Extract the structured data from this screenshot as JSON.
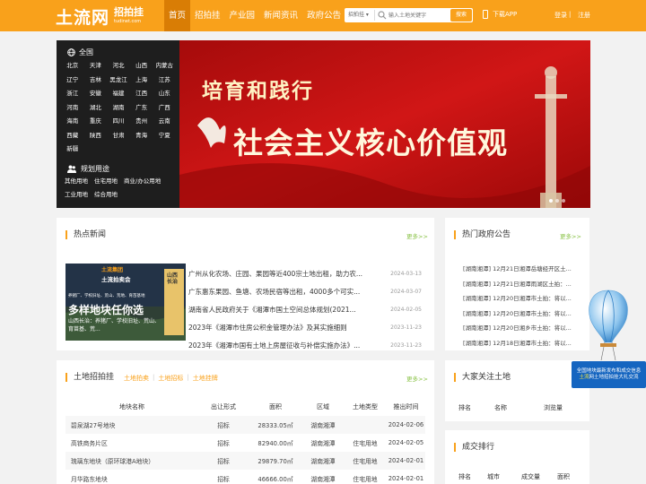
{
  "header": {
    "logo_text": "土流网",
    "logo_sub_cn": "招拍挂",
    "logo_sub_en": "tudinet.com",
    "nav": [
      "首页",
      "招拍挂",
      "产业园",
      "新闻资讯",
      "政府公告"
    ],
    "search_type": "招拍挂 ▾",
    "search_placeholder": "输入土地关键字",
    "search_button": "搜索",
    "app_link": "下载APP",
    "login": "登录",
    "separator": "|",
    "register": "注册",
    "accent_color": "#f9a11b"
  },
  "regions": {
    "heading": "全国",
    "provinces": [
      "北京",
      "天津",
      "河北",
      "山西",
      "内蒙古",
      "辽宁",
      "吉林",
      "黑龙江",
      "上海",
      "江苏",
      "浙江",
      "安徽",
      "福建",
      "江西",
      "山东",
      "河南",
      "湖北",
      "湖南",
      "广东",
      "广西",
      "海南",
      "重庆",
      "四川",
      "贵州",
      "云南",
      "西藏",
      "陕西",
      "甘肃",
      "青海",
      "宁夏",
      "新疆"
    ],
    "plan_heading": "规划用途",
    "uses": [
      "其他用地",
      "住宅用地",
      "商业/办公用地",
      "工业用地",
      "综合用地"
    ]
  },
  "banner": {
    "line1": "培育和践行",
    "line2": "社会主义核心价值观"
  },
  "hot_news": {
    "title": "热点新闻",
    "more": "更多>>",
    "image_brand": "土流集团",
    "image_tag": "土流拍卖会",
    "image_caption1": "养猪厂、学校旧址、荒山、荒地、育苗基地",
    "image_caption_big": "多样地块任你选",
    "image_caption2": "山西长治：养猪厂、学校旧址、荒山、育苗基、荒...",
    "image_side": "山西长治",
    "items": [
      {
        "title": "广州从化农场、庄园、果园等近400宗土地出租，助力农...",
        "date": "2024-03-13"
      },
      {
        "title": "广东惠东果园、鱼塘、农场民宿等出租，4000多个可实...",
        "date": "2024-03-07"
      },
      {
        "title": "湖南省人民政府关于《湘潭市国土空间总体规划(2021...",
        "date": "2024-02-05"
      },
      {
        "title": "2023年《湘潭市住房公积金管理办法》及其实施细则",
        "date": "2023-11-23"
      },
      {
        "title": "2023年《湘潭市国有土地上房屋征收与补偿实施办法》...",
        "date": "2023-11-23"
      }
    ]
  },
  "gov_notice": {
    "title": "热门政府公告",
    "more": "更多>>",
    "items": [
      "[湖南湘潭] 12月21日湘潭岳塘经开区土...",
      "[湖南湘潭] 12月21日湘潭雨湖区土拍：...",
      "[湖南湘潭] 12月20日湘潭市土拍：将以...",
      "[湖南湘潭] 12月20日湘潭市土拍：将以...",
      "[湖南湘潭] 12月20日湘乡市土拍：将以...",
      "[湖南湘潭] 12月18日湘潭市土拍：将以...",
      "[湖南湘潭] 12月1日韶山市土拍：将以起..."
    ]
  },
  "land": {
    "title": "土地招拍挂",
    "tabs": [
      "土地拍卖",
      "土地招标",
      "土地挂牌"
    ],
    "tab_sep": "|",
    "more": "更多>>",
    "columns": [
      "地块名称",
      "出让形式",
      "面积",
      "区域",
      "土地类型",
      "推出时间"
    ],
    "rows": [
      [
        "碧泉湖27号地块",
        "招标",
        "28333.05㎡",
        "湖南湘潭",
        "",
        "2024-02-06"
      ],
      [
        "高铁商务片区",
        "招标",
        "82940.00㎡",
        "湖南湘潭",
        "住宅用地",
        "2024-02-05"
      ],
      [
        "琉璃东地块（原环球港A地块）",
        "招标",
        "29879.70㎡",
        "湖南湘潭",
        "住宅用地",
        "2024-02-01"
      ],
      [
        "月华路东地块",
        "招标",
        "46666.00㎡",
        "湖南湘潭",
        "住宅用地",
        "2024-02-01"
      ]
    ]
  },
  "focus": {
    "title": "大家关注土地",
    "columns": [
      "排名",
      "名称",
      "浏览量"
    ]
  },
  "deal_rank": {
    "title": "成交排行",
    "columns": [
      "排名",
      "城市",
      "成交量",
      "面积"
    ]
  },
  "float_ad": {
    "line1": "全国地块最新发布和成交信息",
    "line2_a": "土流",
    "line2_b": "网土地招拍挂大礼交流"
  }
}
